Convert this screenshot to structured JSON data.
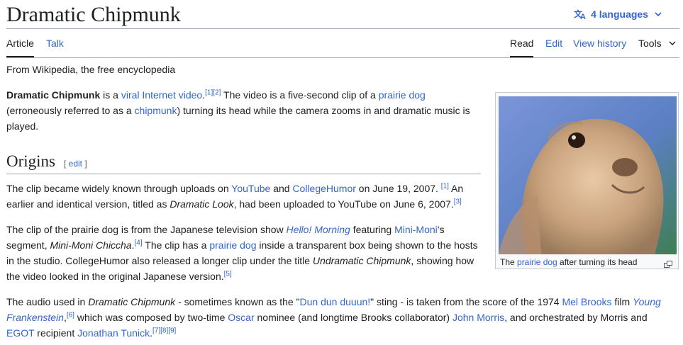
{
  "header": {
    "title": "Dramatic Chipmunk",
    "languages_label": "4 languages"
  },
  "tabs": {
    "article": "Article",
    "talk": "Talk",
    "read": "Read",
    "edit": "Edit",
    "view_history": "View history",
    "tools": "Tools"
  },
  "tagline": "From Wikipedia, the free encyclopedia",
  "intro": {
    "bold_name": "Dramatic Chipmunk",
    "t1": " is a ",
    "link_viral": "viral Internet video",
    "t2": ".",
    "ref1": "[1]",
    "ref2": "[2]",
    "t3": " The video is a five-second clip of a ",
    "link_prairie": "prairie dog",
    "t4": "(erroneously referred to as a ",
    "link_chipmunk": "chipmunk",
    "t5": ") turning its head while the camera zooms in and dramatic music is",
    "t6": "played."
  },
  "origins": {
    "heading": "Origins",
    "edit_open": "[ ",
    "edit_label": "edit",
    "edit_close": " ]"
  },
  "para1": {
    "t1": "The clip became widely known through uploads on ",
    "link_youtube": "YouTube",
    "t2": " and ",
    "link_collegehumor": "CollegeHumor",
    "t3": " on June 19, 2007. ",
    "ref1": "[1]",
    "t4": " An",
    "t5": "earlier and identical version, titled as ",
    "italic_title": "Dramatic Look",
    "t6": ", had been uploaded to YouTube on June 6, 2007.",
    "ref3": "[3]"
  },
  "para2": {
    "t1": "The clip of the prairie dog is from the Japanese television show ",
    "link_hello": "Hello! Morning",
    "t2": " featuring ",
    "link_minimoni": "Mini-Moni",
    "t3": "'s",
    "t4": "segment, ",
    "italic_segment": "Mini-Moni Chiccha",
    "t5": ".",
    "ref4": "[4]",
    "t6": " The clip has a ",
    "link_prairie": "prairie dog",
    "t7": " inside a transparent box being shown to the hosts",
    "t8": "in the studio. CollegeHumor also released a longer clip under the title ",
    "italic_undramatic": "Undramatic Chipmunk",
    "t9": ", showing how",
    "t10": "the video looked in the original Japanese version.",
    "ref5": "[5]"
  },
  "para3": {
    "t1": "The audio used in ",
    "italic_dc": "Dramatic Chipmunk",
    "t2": " - sometimes known as the \"",
    "link_dundun": "Dun dun duuun!",
    "t3": "\" sting - is taken from the score of the 1974 ",
    "link_melbrooks": "Mel Brooks",
    "t4": " film ",
    "link_young": "Young",
    "link_frank": "Frankenstein",
    "t5": ",",
    "ref6": "[6]",
    "t6": " which was composed by two-time ",
    "link_oscar": "Oscar",
    "t7": " nominee (and longtime Brooks collaborator) ",
    "link_johnmorris": "John Morris",
    "t8": ", and orchestrated by Morris and",
    "link_egot": "EGOT",
    "t9": " recipient ",
    "link_tunick": "Jonathan Tunick",
    "t10": ".",
    "ref789": "[7][8][9]"
  },
  "figure": {
    "caption_t1": "The ",
    "caption_link": "prairie dog",
    "caption_t2": " after turning its head"
  },
  "colors": {
    "link": "#3366cc",
    "text": "#202122",
    "rule": "#a2a9b1"
  }
}
